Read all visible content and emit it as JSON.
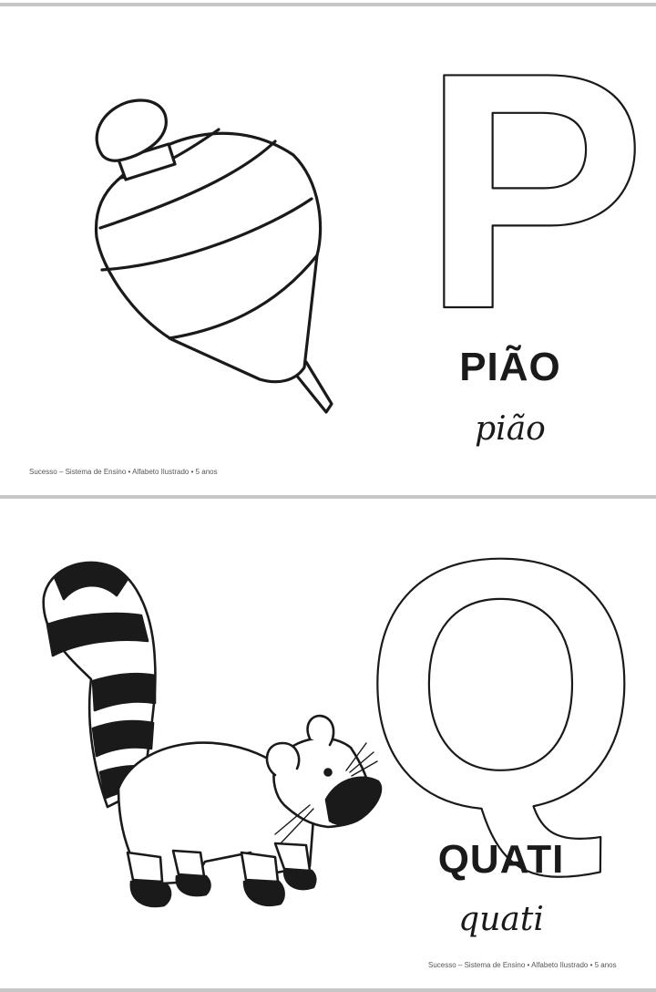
{
  "pages": [
    {
      "letter": "P",
      "word_print": "PIÃO",
      "word_cursive": "pião",
      "illustration_icon": "spinning-top-icon",
      "footer": "Sucesso – Sistema de Ensino • Alfabeto Ilustrado • 5 anos"
    },
    {
      "letter": "Q",
      "word_print": "QUATI",
      "word_cursive": "quati",
      "illustration_icon": "coati-icon",
      "footer": "Sucesso – Sistema de Ensino • Alfabeto Ilustrado • 5 anos"
    }
  ],
  "colors": {
    "ink": "#1a1a1a",
    "divider": "#c6c6c6",
    "paper": "#ffffff"
  }
}
